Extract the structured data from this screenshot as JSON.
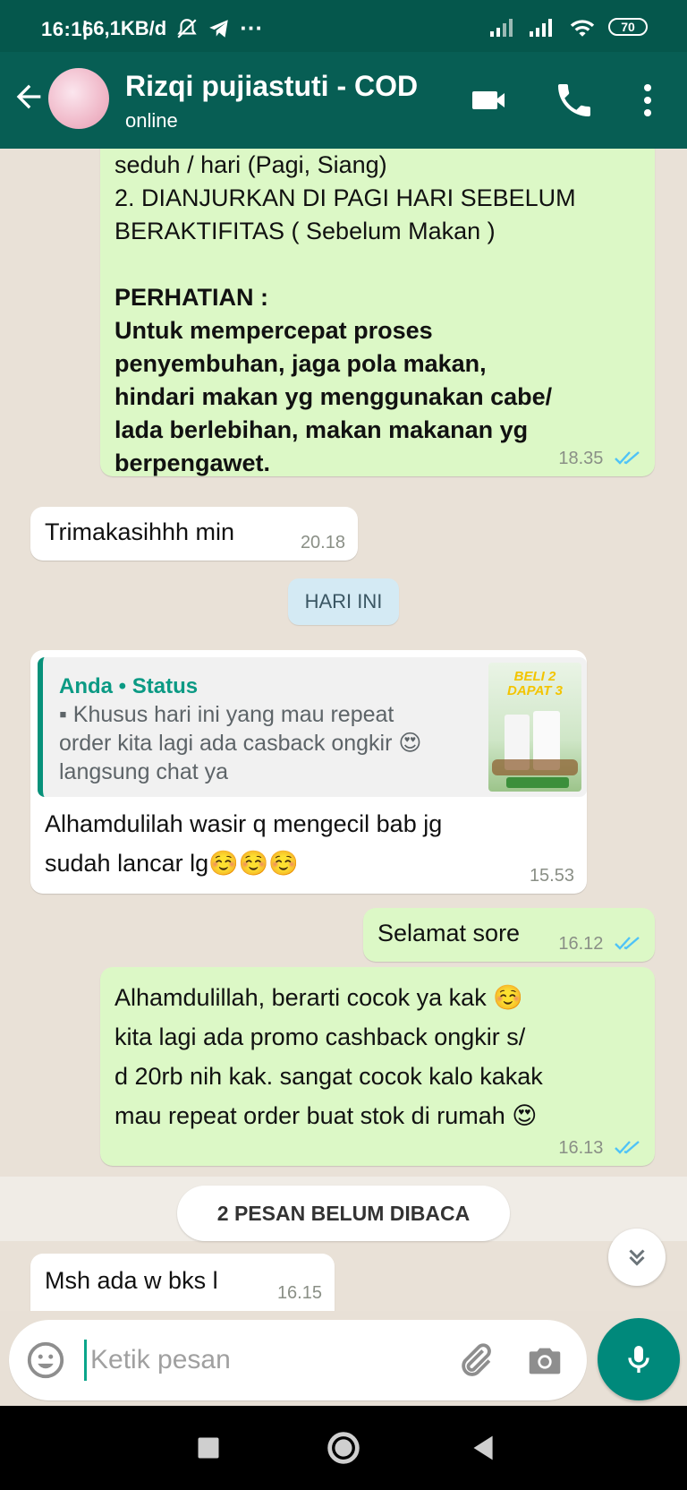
{
  "status_bar": {
    "time": "16:16",
    "net_speed": "| 6,1KB/d",
    "battery": "70"
  },
  "header": {
    "contact_name": "Rizqi pujiastuti  - COD",
    "contact_status": "online",
    "icons": [
      "back-arrow-icon",
      "video-call-icon",
      "phone-icon",
      "more-vert-icon"
    ]
  },
  "messages": [
    {
      "type": "outgoing",
      "lines": [
        "seduh / hari (Pagi, Siang)",
        "2. DIANJURKAN DI PAGI HARI SEBELUM",
        "BERAKTIFITAS ( Sebelum Makan )"
      ],
      "bold_heading": "PERHATIAN :",
      "bold_lines": [
        "Untuk mempercepat proses",
        "penyembuhan, jaga pola makan,",
        "hindari makan yg menggunakan cabe/",
        "lada berlebihan, makan makanan yg",
        "berpengawet."
      ],
      "time": "18.35"
    },
    {
      "type": "incoming",
      "text": "Trimakasihhh min",
      "time": "20.18"
    },
    {
      "type": "incoming",
      "quote_author": "Anda • Status",
      "quote_lines": [
        "▪ Khusus hari ini yang mau repeat",
        "order kita lagi ada casback ongkir 😍",
        "langsung chat ya"
      ],
      "thumb_text": "BELI 2 DAPAT 3",
      "lines": [
        "Alhamdulilah wasir q mengecil bab jg",
        "sudah lancar lg☺️☺️☺️"
      ],
      "time": "15.53"
    },
    {
      "type": "outgoing",
      "text": "Selamat sore",
      "time": "16.12"
    },
    {
      "type": "outgoing",
      "lines": [
        "Alhamdulillah, berarti cocok ya kak ☺️",
        "kita lagi ada promo cashback ongkir s/",
        "d 20rb nih kak. sangat cocok kalo kakak",
        "mau repeat order buat stok di rumah 😍"
      ],
      "time": "16.13"
    },
    {
      "type": "incoming",
      "text": "Msh ada w bks l",
      "time": "16.15"
    }
  ],
  "date_chip": "HARI INI",
  "unread_banner": "2 PESAN BELUM DIBACA",
  "composer": {
    "placeholder": "Ketik pesan",
    "icons": [
      "emoji-icon",
      "attach-icon",
      "camera-icon",
      "mic-icon"
    ]
  },
  "colors": {
    "header": "#075e54",
    "outgoing_bubble": "#dcf8c6",
    "incoming_bubble": "#ffffff",
    "accent": "#00897b",
    "read_ticks": "#4fc3f7"
  }
}
